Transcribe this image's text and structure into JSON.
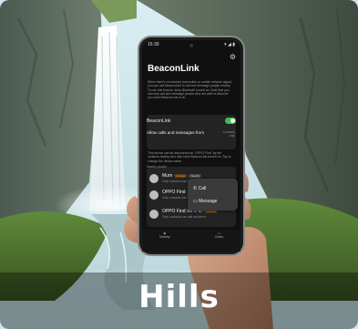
{
  "caption": "Hills",
  "phone": {
    "status_time": "16:30",
    "status_icons": "▾ ◢ ▮",
    "app_title": "BeaconLink",
    "settings_icon": "gear-icon",
    "description": "When there's no internet connection or mobile network signal, you can use BeaconLink to call and message people nearby. To use this feature, keep Bluetooth turned on. Note that you can only call and message people who are able to discover you when BeaconLink is on.",
    "toggle_label": "BeaconLink",
    "toggle_on": true,
    "allow_label": "Allow calls and messages from",
    "allow_value": "Contacts only",
    "device_note": "This device can be discovered as \"OPPO Find\" by the contacts nearby who also have BeaconLink turned on. Tap to change the device name.",
    "nearby_header": "Nearby people",
    "people": [
      {
        "name": "Mum",
        "badges": [
          "Contact",
          "Nearby"
        ],
        "sub": "Only contacts can call and send messages"
      },
      {
        "name": "OPPO Find",
        "badges": [],
        "sub": "Only contacts can call and send messages"
      },
      {
        "name": "OPPO Find X8 LHD",
        "badges": [
          "Contact"
        ],
        "sub": "Only contacts can call and send"
      }
    ],
    "popup": {
      "call": "Call",
      "message": "Message"
    },
    "nav": {
      "left": "Nearby",
      "right": "Chats"
    }
  }
}
